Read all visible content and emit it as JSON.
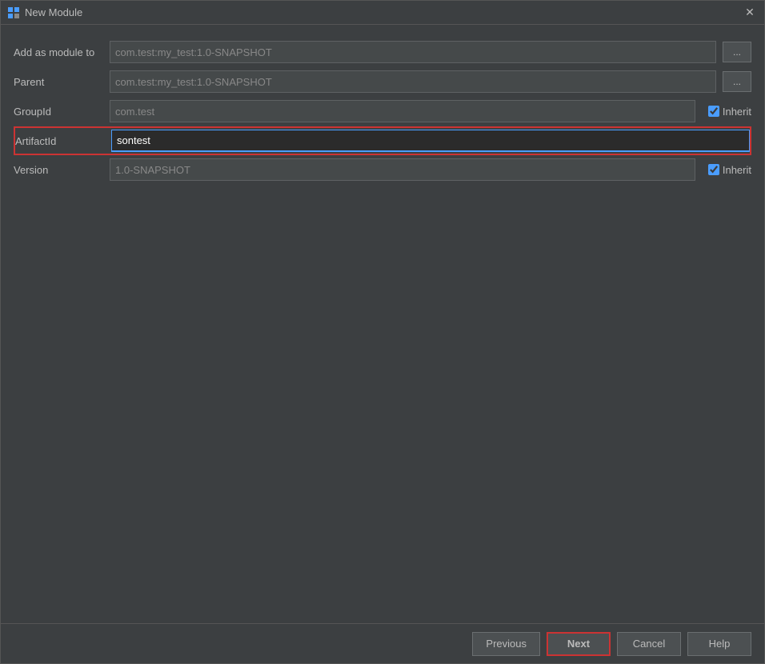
{
  "window": {
    "title": "New Module",
    "close_label": "✕"
  },
  "form": {
    "add_as_module_label": "Add as module to",
    "add_as_module_value": "com.test:my_test:1.0-SNAPSHOT",
    "parent_label": "Parent",
    "parent_value": "com.test:my_test:1.0-SNAPSHOT",
    "groupid_label": "GroupId",
    "groupid_value": "com.test",
    "groupid_inherit_label": "Inherit",
    "artifactid_label": "ArtifactId",
    "artifactid_value": "sontest",
    "version_label": "Version",
    "version_value": "1.0-SNAPSHOT",
    "version_inherit_label": "Inherit",
    "browse_label": "..."
  },
  "footer": {
    "previous_label": "Previous",
    "next_label": "Next",
    "cancel_label": "Cancel",
    "help_label": "Help"
  }
}
